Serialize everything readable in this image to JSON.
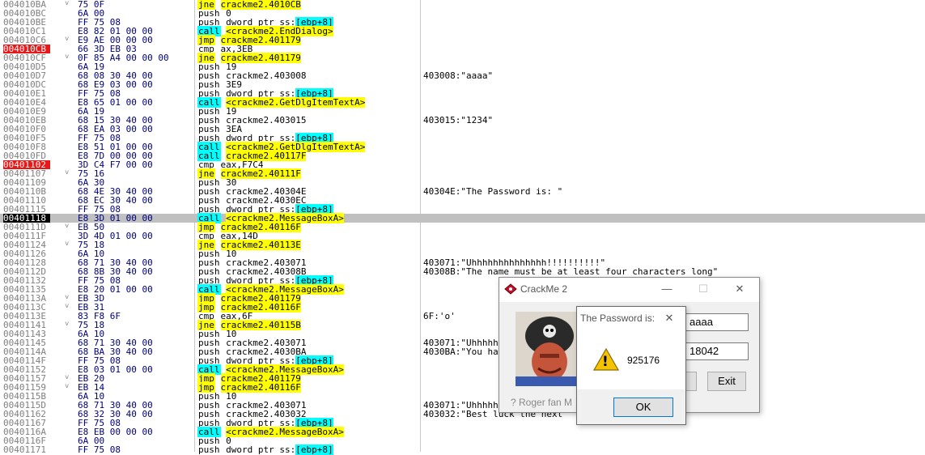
{
  "disasm": [
    {
      "addr": "004010BA",
      "arrow": "˅",
      "bytes": "75 0F",
      "mnem": "jne",
      "op": "crackme2.4010CB",
      "kind": "jcc",
      "cmt": ""
    },
    {
      "addr": "004010BC",
      "arrow": "",
      "bytes": "6A 00",
      "mnem": "push",
      "op": "0",
      "kind": "",
      "cmt": ""
    },
    {
      "addr": "004010BE",
      "arrow": "",
      "bytes": "FF 75 08",
      "mnem": "push",
      "op": "dword ptr ss:[ebp+8]",
      "kind": "",
      "cmt": ""
    },
    {
      "addr": "004010C1",
      "arrow": "",
      "bytes": "E8 82 01 00 00",
      "mnem": "call",
      "op": "<crackme2.EndDialog>",
      "kind": "call",
      "cmt": ""
    },
    {
      "addr": "004010C6",
      "arrow": "˅",
      "bytes": "E9 AE 00 00 00",
      "mnem": "jmp",
      "op": "crackme2.401179",
      "kind": "jmp",
      "cmt": ""
    },
    {
      "addr": "004010CB",
      "arrow": "",
      "bytes": "66 3D EB 03",
      "mnem": "cmp",
      "op": "ax,3EB",
      "kind": "",
      "cmt": "",
      "bp": true
    },
    {
      "addr": "004010CF",
      "arrow": "˅",
      "bytes": "0F 85 A4 00 00 00",
      "mnem": "jne",
      "op": "crackme2.401179",
      "kind": "jcc",
      "cmt": ""
    },
    {
      "addr": "004010D5",
      "arrow": "",
      "bytes": "6A 19",
      "mnem": "push",
      "op": "19",
      "kind": "",
      "cmt": ""
    },
    {
      "addr": "004010D7",
      "arrow": "",
      "bytes": "68 08 30 40 00",
      "mnem": "push",
      "op": "crackme2.403008",
      "kind": "",
      "cmt": "403008:\"aaaa\""
    },
    {
      "addr": "004010DC",
      "arrow": "",
      "bytes": "68 E9 03 00 00",
      "mnem": "push",
      "op": "3E9",
      "kind": "",
      "cmt": ""
    },
    {
      "addr": "004010E1",
      "arrow": "",
      "bytes": "FF 75 08",
      "mnem": "push",
      "op": "dword ptr ss:[ebp+8]",
      "kind": "",
      "cmt": ""
    },
    {
      "addr": "004010E4",
      "arrow": "",
      "bytes": "E8 65 01 00 00",
      "mnem": "call",
      "op": "<crackme2.GetDlgItemTextA>",
      "kind": "call",
      "cmt": ""
    },
    {
      "addr": "004010E9",
      "arrow": "",
      "bytes": "6A 19",
      "mnem": "push",
      "op": "19",
      "kind": "",
      "cmt": ""
    },
    {
      "addr": "004010EB",
      "arrow": "",
      "bytes": "68 15 30 40 00",
      "mnem": "push",
      "op": "crackme2.403015",
      "kind": "",
      "cmt": "403015:\"1234\""
    },
    {
      "addr": "004010F0",
      "arrow": "",
      "bytes": "68 EA 03 00 00",
      "mnem": "push",
      "op": "3EA",
      "kind": "",
      "cmt": ""
    },
    {
      "addr": "004010F5",
      "arrow": "",
      "bytes": "FF 75 08",
      "mnem": "push",
      "op": "dword ptr ss:[ebp+8]",
      "kind": "",
      "cmt": ""
    },
    {
      "addr": "004010F8",
      "arrow": "",
      "bytes": "E8 51 01 00 00",
      "mnem": "call",
      "op": "<crackme2.GetDlgItemTextA>",
      "kind": "call",
      "cmt": ""
    },
    {
      "addr": "004010FD",
      "arrow": "",
      "bytes": "E8 7D 00 00 00",
      "mnem": "call",
      "op": "crackme2.40117F",
      "kind": "call",
      "cmt": ""
    },
    {
      "addr": "00401102",
      "arrow": "",
      "bytes": "3D C4 F7 00 00",
      "mnem": "cmp",
      "op": "eax,F7C4",
      "kind": "",
      "cmt": "",
      "bp": true
    },
    {
      "addr": "00401107",
      "arrow": "˅",
      "bytes": "75 16",
      "mnem": "jne",
      "op": "crackme2.40111F",
      "kind": "jcc",
      "cmt": ""
    },
    {
      "addr": "00401109",
      "arrow": "",
      "bytes": "6A 30",
      "mnem": "push",
      "op": "30",
      "kind": "",
      "cmt": ""
    },
    {
      "addr": "0040110B",
      "arrow": "",
      "bytes": "68 4E 30 40 00",
      "mnem": "push",
      "op": "crackme2.40304E",
      "kind": "",
      "cmt": "40304E:\"The Password is: \""
    },
    {
      "addr": "00401110",
      "arrow": "",
      "bytes": "68 EC 30 40 00",
      "mnem": "push",
      "op": "crackme2.4030EC",
      "kind": "",
      "cmt": ""
    },
    {
      "addr": "00401115",
      "arrow": "",
      "bytes": "FF 75 08",
      "mnem": "push",
      "op": "dword ptr ss:[ebp+8]",
      "kind": "",
      "cmt": ""
    },
    {
      "addr": "00401118",
      "arrow": "",
      "bytes": "E8 3D 01 00 00",
      "mnem": "call",
      "op": "<crackme2.MessageBoxA>",
      "kind": "call",
      "cmt": "",
      "cur": true
    },
    {
      "addr": "0040111D",
      "arrow": "˅",
      "bytes": "EB 50",
      "mnem": "jmp",
      "op": "crackme2.40116F",
      "kind": "jmp",
      "cmt": ""
    },
    {
      "addr": "0040111F",
      "arrow": "",
      "bytes": "3D 4D 01 00 00",
      "mnem": "cmp",
      "op": "eax,14D",
      "kind": "",
      "cmt": ""
    },
    {
      "addr": "00401124",
      "arrow": "˅",
      "bytes": "75 18",
      "mnem": "jne",
      "op": "crackme2.40113E",
      "kind": "jcc",
      "cmt": ""
    },
    {
      "addr": "00401126",
      "arrow": "",
      "bytes": "6A 10",
      "mnem": "push",
      "op": "10",
      "kind": "",
      "cmt": ""
    },
    {
      "addr": "00401128",
      "arrow": "",
      "bytes": "68 71 30 40 00",
      "mnem": "push",
      "op": "crackme2.403071",
      "kind": "",
      "cmt": "403071:\"Uhhhhhhhhhhhhhh!!!!!!!!!!\""
    },
    {
      "addr": "0040112D",
      "arrow": "",
      "bytes": "68 8B 30 40 00",
      "mnem": "push",
      "op": "crackme2.40308B",
      "kind": "",
      "cmt": "40308B:\"The name must be at least four characters long\""
    },
    {
      "addr": "00401132",
      "arrow": "",
      "bytes": "FF 75 08",
      "mnem": "push",
      "op": "dword ptr ss:[ebp+8]",
      "kind": "",
      "cmt": ""
    },
    {
      "addr": "00401135",
      "arrow": "",
      "bytes": "E8 20 01 00 00",
      "mnem": "call",
      "op": "<crackme2.MessageBoxA>",
      "kind": "call",
      "cmt": ""
    },
    {
      "addr": "0040113A",
      "arrow": "˅",
      "bytes": "EB 3D",
      "mnem": "jmp",
      "op": "crackme2.401179",
      "kind": "jmp",
      "cmt": ""
    },
    {
      "addr": "0040113C",
      "arrow": "˅",
      "bytes": "EB 31",
      "mnem": "jmp",
      "op": "crackme2.40116F",
      "kind": "jmp",
      "cmt": ""
    },
    {
      "addr": "0040113E",
      "arrow": "",
      "bytes": "83 F8 6F",
      "mnem": "cmp",
      "op": "eax,6F",
      "kind": "",
      "cmt": "6F:'o'"
    },
    {
      "addr": "00401141",
      "arrow": "˅",
      "bytes": "75 18",
      "mnem": "jne",
      "op": "crackme2.40115B",
      "kind": "jcc",
      "cmt": ""
    },
    {
      "addr": "00401143",
      "arrow": "",
      "bytes": "6A 10",
      "mnem": "push",
      "op": "10",
      "kind": "",
      "cmt": ""
    },
    {
      "addr": "00401145",
      "arrow": "",
      "bytes": "68 71 30 40 00",
      "mnem": "push",
      "op": "crackme2.403071",
      "kind": "",
      "cmt": "403071:\"Uhhhhh"
    },
    {
      "addr": "0040114A",
      "arrow": "",
      "bytes": "68 BA 30 40 00",
      "mnem": "push",
      "op": "crackme2.4030BA",
      "kind": "",
      "cmt": "4030BA:\"You ha"
    },
    {
      "addr": "0040114F",
      "arrow": "",
      "bytes": "FF 75 08",
      "mnem": "push",
      "op": "dword ptr ss:[ebp+8]",
      "kind": "",
      "cmt": ""
    },
    {
      "addr": "00401152",
      "arrow": "",
      "bytes": "E8 03 01 00 00",
      "mnem": "call",
      "op": "<crackme2.MessageBoxA>",
      "kind": "call",
      "cmt": ""
    },
    {
      "addr": "00401157",
      "arrow": "˅",
      "bytes": "EB 20",
      "mnem": "jmp",
      "op": "crackme2.401179",
      "kind": "jmp",
      "cmt": ""
    },
    {
      "addr": "00401159",
      "arrow": "˅",
      "bytes": "EB 14",
      "mnem": "jmp",
      "op": "crackme2.40116F",
      "kind": "jmp",
      "cmt": ""
    },
    {
      "addr": "0040115B",
      "arrow": "",
      "bytes": "6A 10",
      "mnem": "push",
      "op": "10",
      "kind": "",
      "cmt": ""
    },
    {
      "addr": "0040115D",
      "arrow": "",
      "bytes": "68 71 30 40 00",
      "mnem": "push",
      "op": "crackme2.403071",
      "kind": "",
      "cmt": "403071:\"Uhhhhh"
    },
    {
      "addr": "00401162",
      "arrow": "",
      "bytes": "68 32 30 40 00",
      "mnem": "push",
      "op": "crackme2.403032",
      "kind": "",
      "cmt": "403032:\"Best luck the next"
    },
    {
      "addr": "00401167",
      "arrow": "",
      "bytes": "FF 75 08",
      "mnem": "push",
      "op": "dword ptr ss:[ebp+8]",
      "kind": "",
      "cmt": ""
    },
    {
      "addr": "0040116A",
      "arrow": "",
      "bytes": "E8 EB 00 00 00",
      "mnem": "call",
      "op": "<crackme2.MessageBoxA>",
      "kind": "call",
      "cmt": ""
    },
    {
      "addr": "0040116F",
      "arrow": "",
      "bytes": "6A 00",
      "mnem": "push",
      "op": "0",
      "kind": "",
      "cmt": ""
    },
    {
      "addr": "00401171",
      "arrow": "",
      "bytes": "FF 75 08",
      "mnem": "push",
      "op": "dword ptr ss:[ebp+8]",
      "kind": "",
      "cmt": ""
    }
  ],
  "crackme": {
    "title": "CrackMe 2",
    "name_value": "aaaa",
    "serial_value": "18042",
    "exit_label": "Exit",
    "footer_text": "? Roger fan M",
    "minimize_glyph": "—",
    "maximize_glyph": "☐",
    "close_glyph": "✕"
  },
  "msgbox": {
    "title": "The Password is:",
    "message": "925176",
    "ok_label": "OK",
    "close_glyph": "✕",
    "warning_glyph": "!"
  },
  "colors": {
    "breakpoint": "#e81818",
    "current_line": "#c0c0c0",
    "jump_highlight": "#ffff00",
    "call_highlight": "#00ffff"
  }
}
